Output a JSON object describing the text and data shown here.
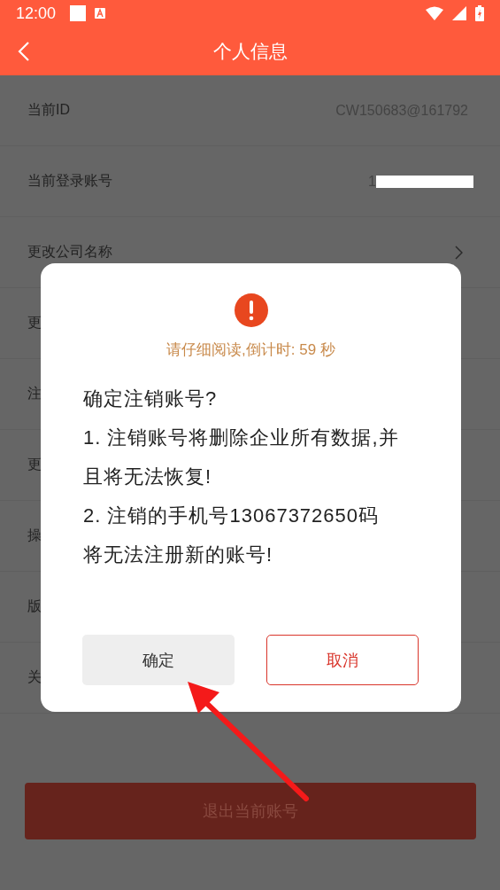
{
  "status_bar": {
    "time": "12:00"
  },
  "header": {
    "title": "个人信息"
  },
  "rows": [
    {
      "label": "当前ID",
      "value": "CW150683@161792",
      "kind": "text"
    },
    {
      "label": "当前登录账号",
      "value": "1",
      "kind": "redacted"
    },
    {
      "label": "更改公司名称",
      "kind": "link"
    },
    {
      "label": "更",
      "kind": "plain"
    },
    {
      "label": "注",
      "kind": "plain"
    },
    {
      "label": "更",
      "kind": "plain"
    },
    {
      "label": "操",
      "kind": "plain"
    },
    {
      "label": "版",
      "kind": "plain"
    },
    {
      "label": "关",
      "kind": "plain"
    }
  ],
  "logout_button": {
    "label": "退出当前账号"
  },
  "dialog": {
    "countdown": "请仔细阅读,倒计时: 59 秒",
    "paragraphs": [
      "确定注销账号?",
      "1. 注销账号将删除企业所有数据,并且将无法恢复!",
      "2. 注销的手机号13067372650码将无法注册新的账号!"
    ],
    "buttons": [
      {
        "label": "确定",
        "kind": "confirm"
      },
      {
        "label": "取消",
        "kind": "cancel"
      }
    ]
  }
}
